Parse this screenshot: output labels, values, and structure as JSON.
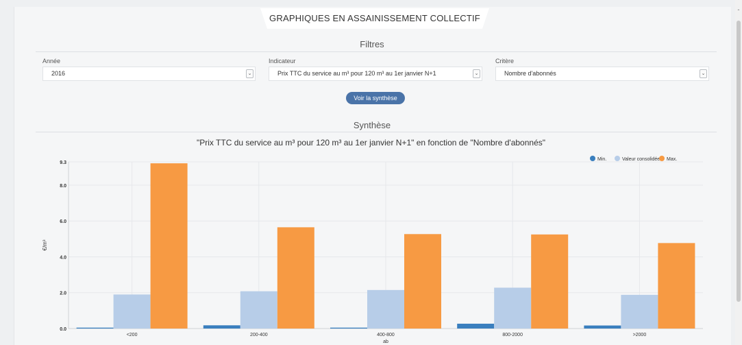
{
  "header": {
    "title": "GRAPHIQUES EN ASSAINISSEMENT COLLECTIF"
  },
  "filters": {
    "title": "Filtres",
    "annee": {
      "label": "Année",
      "value": "2016"
    },
    "indicateur": {
      "label": "Indicateur",
      "value": "Prix TTC du service au m³ pour 120 m³ au 1er janvier N+1"
    },
    "critere": {
      "label": "Critère",
      "value": "Nombre d'abonnés"
    },
    "button_label": "Voir la synthèse"
  },
  "synthese": {
    "title": "Synthèse",
    "chart_title": "\"Prix TTC du service au m³ pour 120 m³ au 1er janvier N+1\" en fonction de \"Nombre d'abonnés\""
  },
  "colors": {
    "min": "#3a7fbe",
    "consolidee": "#b7cde8",
    "max": "#f79a43",
    "button": "#4a73a8"
  },
  "chart_data": {
    "type": "bar",
    "title": "\"Prix TTC du service au m³ pour 120 m³ au 1er janvier N+1\" en fonction de \"Nombre d'abonnés\"",
    "xlabel": "ab",
    "ylabel": "€/m³",
    "categories": [
      "<200",
      "200-400",
      "400-800",
      "800-2000",
      ">2000"
    ],
    "series": [
      {
        "name": "Min.",
        "values": [
          0.05,
          0.18,
          0.05,
          0.27,
          0.17
        ]
      },
      {
        "name": "Valeur consolidée",
        "values": [
          1.9,
          2.08,
          2.15,
          2.28,
          1.88
        ]
      },
      {
        "name": "Max.",
        "values": [
          9.22,
          5.65,
          5.27,
          5.25,
          4.77
        ]
      }
    ],
    "ylim": [
      0,
      9.3
    ],
    "yticks": [
      "0.0",
      "2.0",
      "4.0",
      "6.0",
      "8.0",
      "9.3"
    ],
    "legend": "top-right",
    "grid": true
  }
}
